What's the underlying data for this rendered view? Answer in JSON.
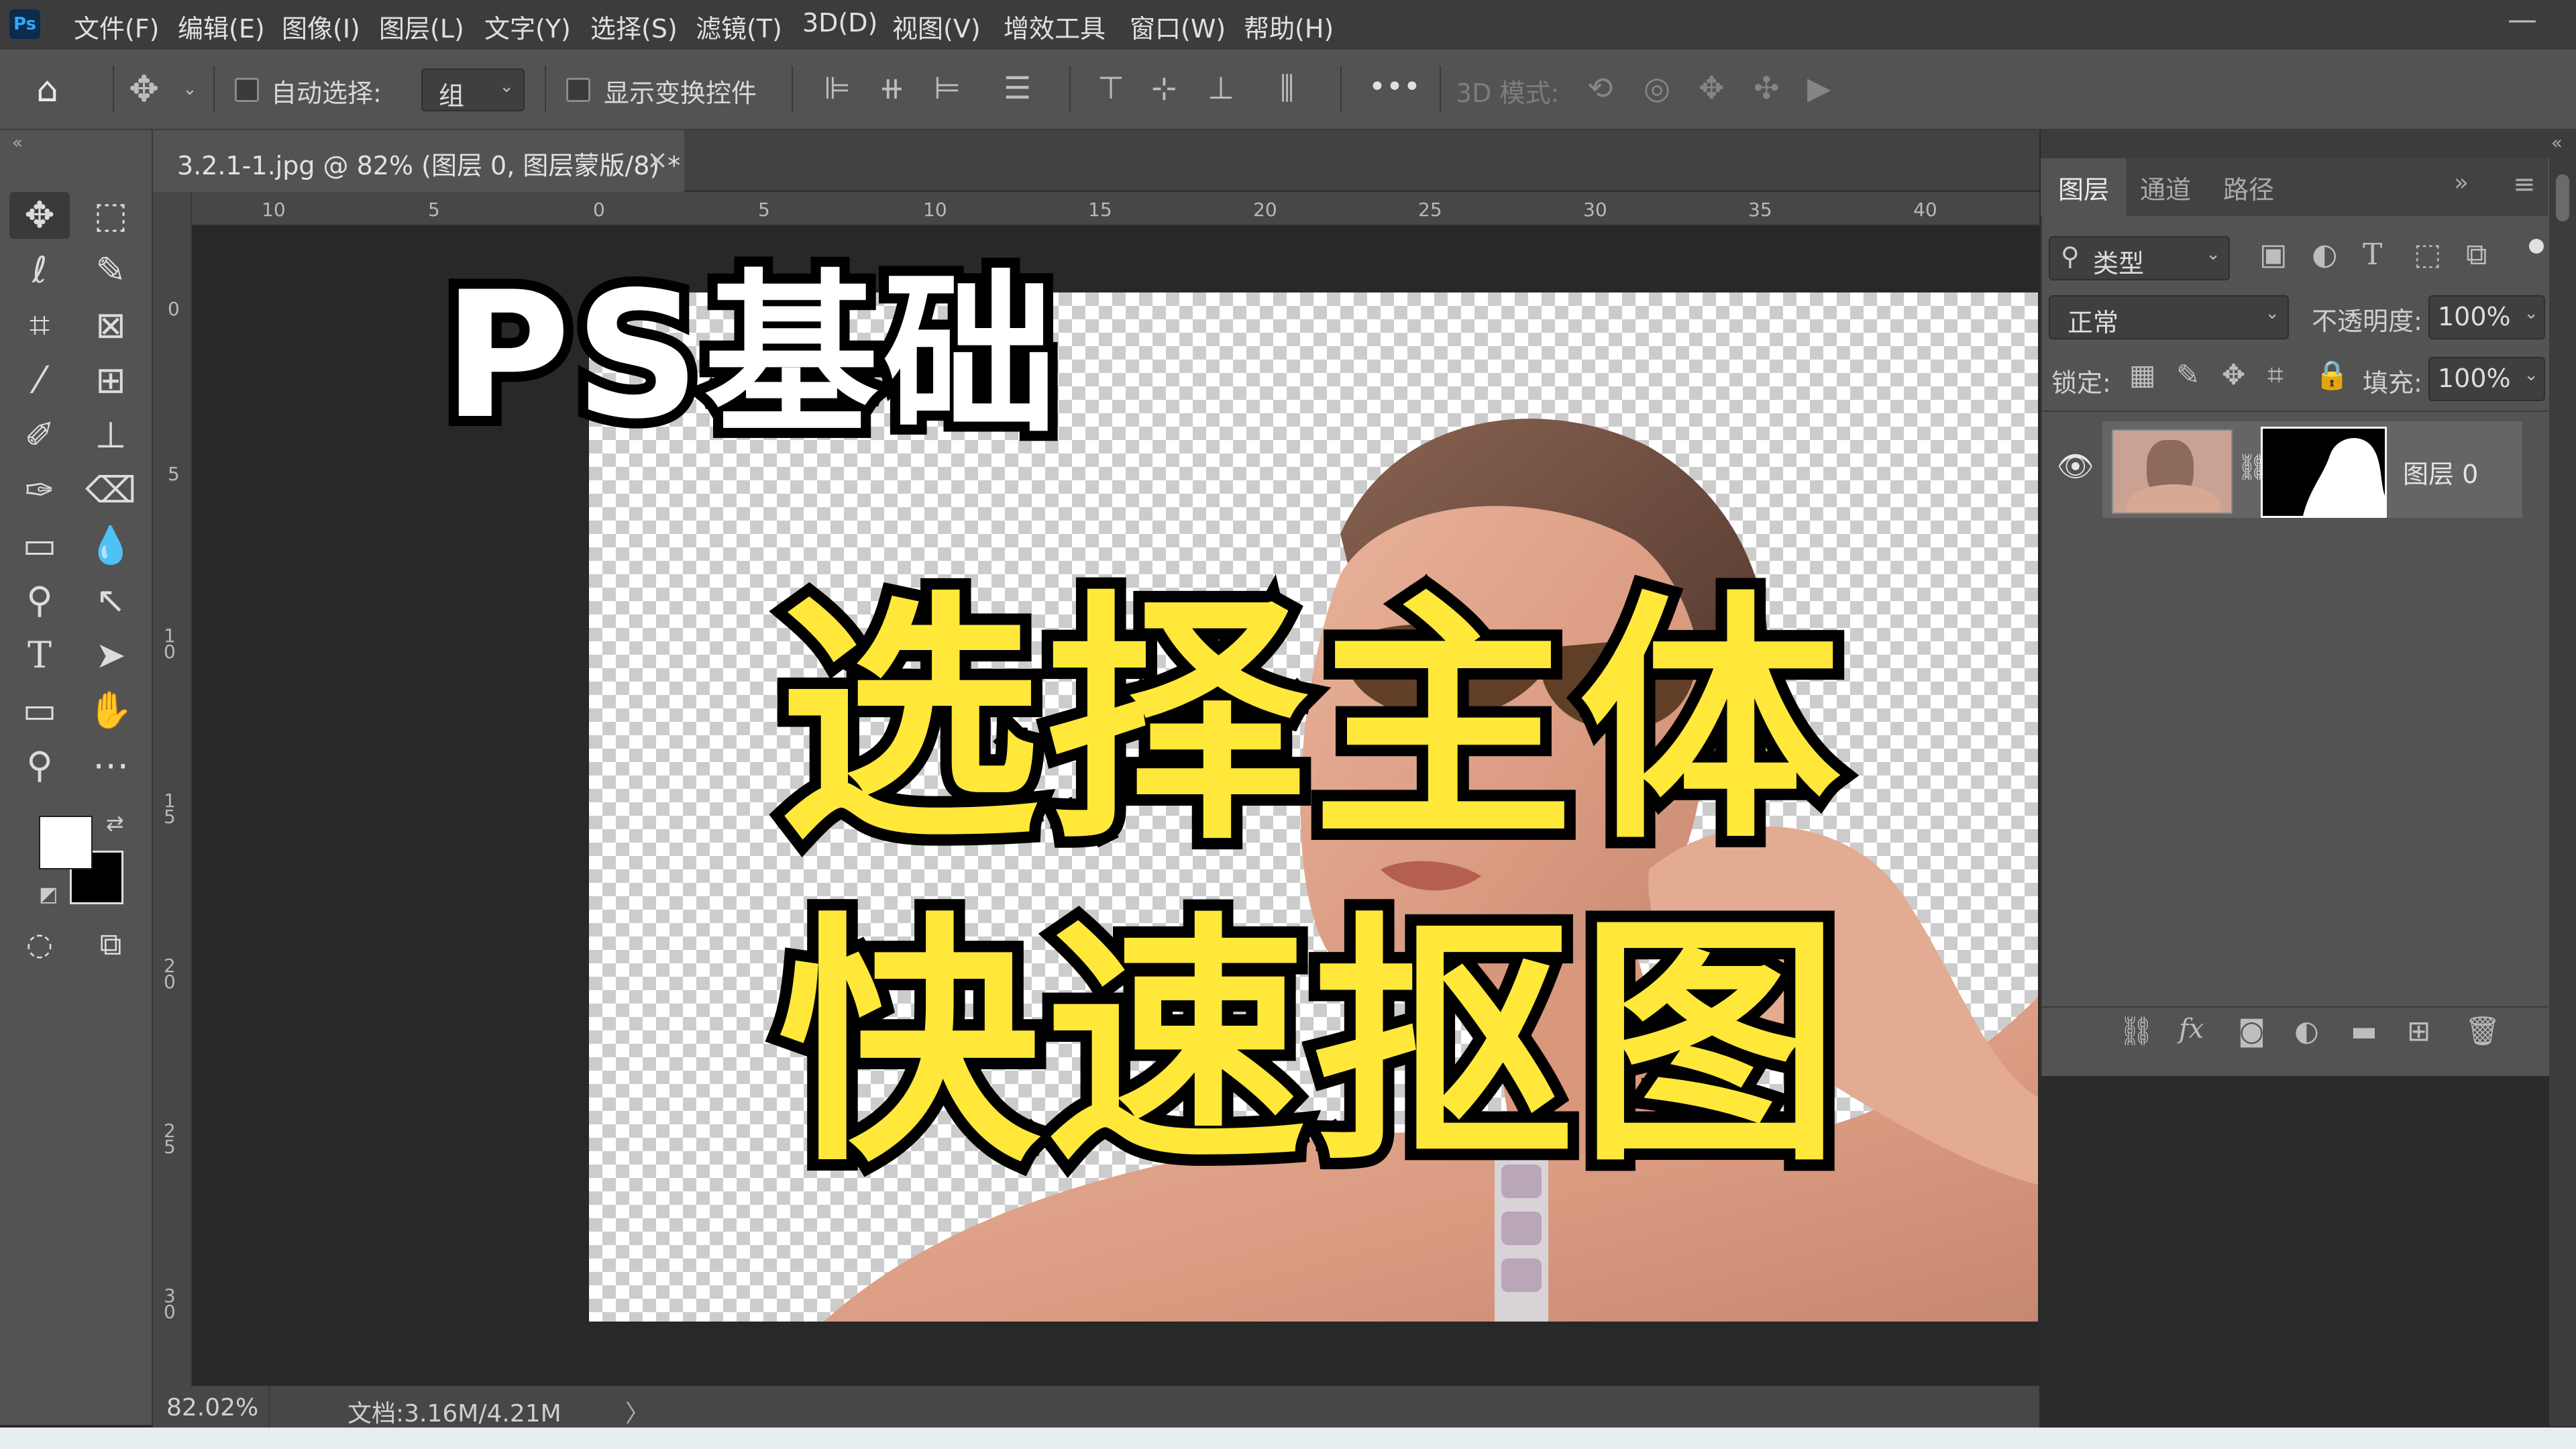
{
  "menu": {
    "logo": "Ps",
    "items": [
      "文件(F)",
      "编辑(E)",
      "图像(I)",
      "图层(L)",
      "文字(Y)",
      "选择(S)",
      "滤镜(T)",
      "3D(D)",
      "视图(V)",
      "增效工具",
      "窗口(W)",
      "帮助(H)"
    ],
    "minimize": "—"
  },
  "options": {
    "auto_select_label": "自动选择:",
    "auto_select_value": "组",
    "show_transform_label": "显示变换控件",
    "mode_3d_label": "3D 模式:",
    "more": "•••"
  },
  "document": {
    "tab_title": "3.2.1-1.jpg @ 82% (图层 0, 图层蒙版/8) *",
    "close": "×"
  },
  "ruler": {
    "h_ticks": [
      "10",
      "5",
      "0",
      "5",
      "10",
      "15",
      "20",
      "25",
      "30",
      "35",
      "40"
    ],
    "v_ticks": [
      "0",
      "5",
      "10",
      "15",
      "20",
      "25",
      "30"
    ]
  },
  "status": {
    "zoom": "82.02%",
    "doc_info": "文档:3.16M/4.21M",
    "arrow": "〉"
  },
  "panel": {
    "tabs": [
      "图层",
      "通道",
      "路径"
    ],
    "filter_label": "类型",
    "blend_mode": "正常",
    "opacity_label": "不透明度:",
    "opacity_value": "100%",
    "lock_label": "锁定:",
    "fill_label": "填充:",
    "fill_value": "100%",
    "layer_name": "图层 0",
    "fx_label": "fx"
  },
  "overlay": {
    "line1": "PS基础",
    "line2": "选择主体",
    "line3": "快速抠图"
  },
  "colors": {
    "title_yellow": "#ffe83a",
    "ps_blue": "#31a8ff",
    "panel_bg": "#535353"
  }
}
